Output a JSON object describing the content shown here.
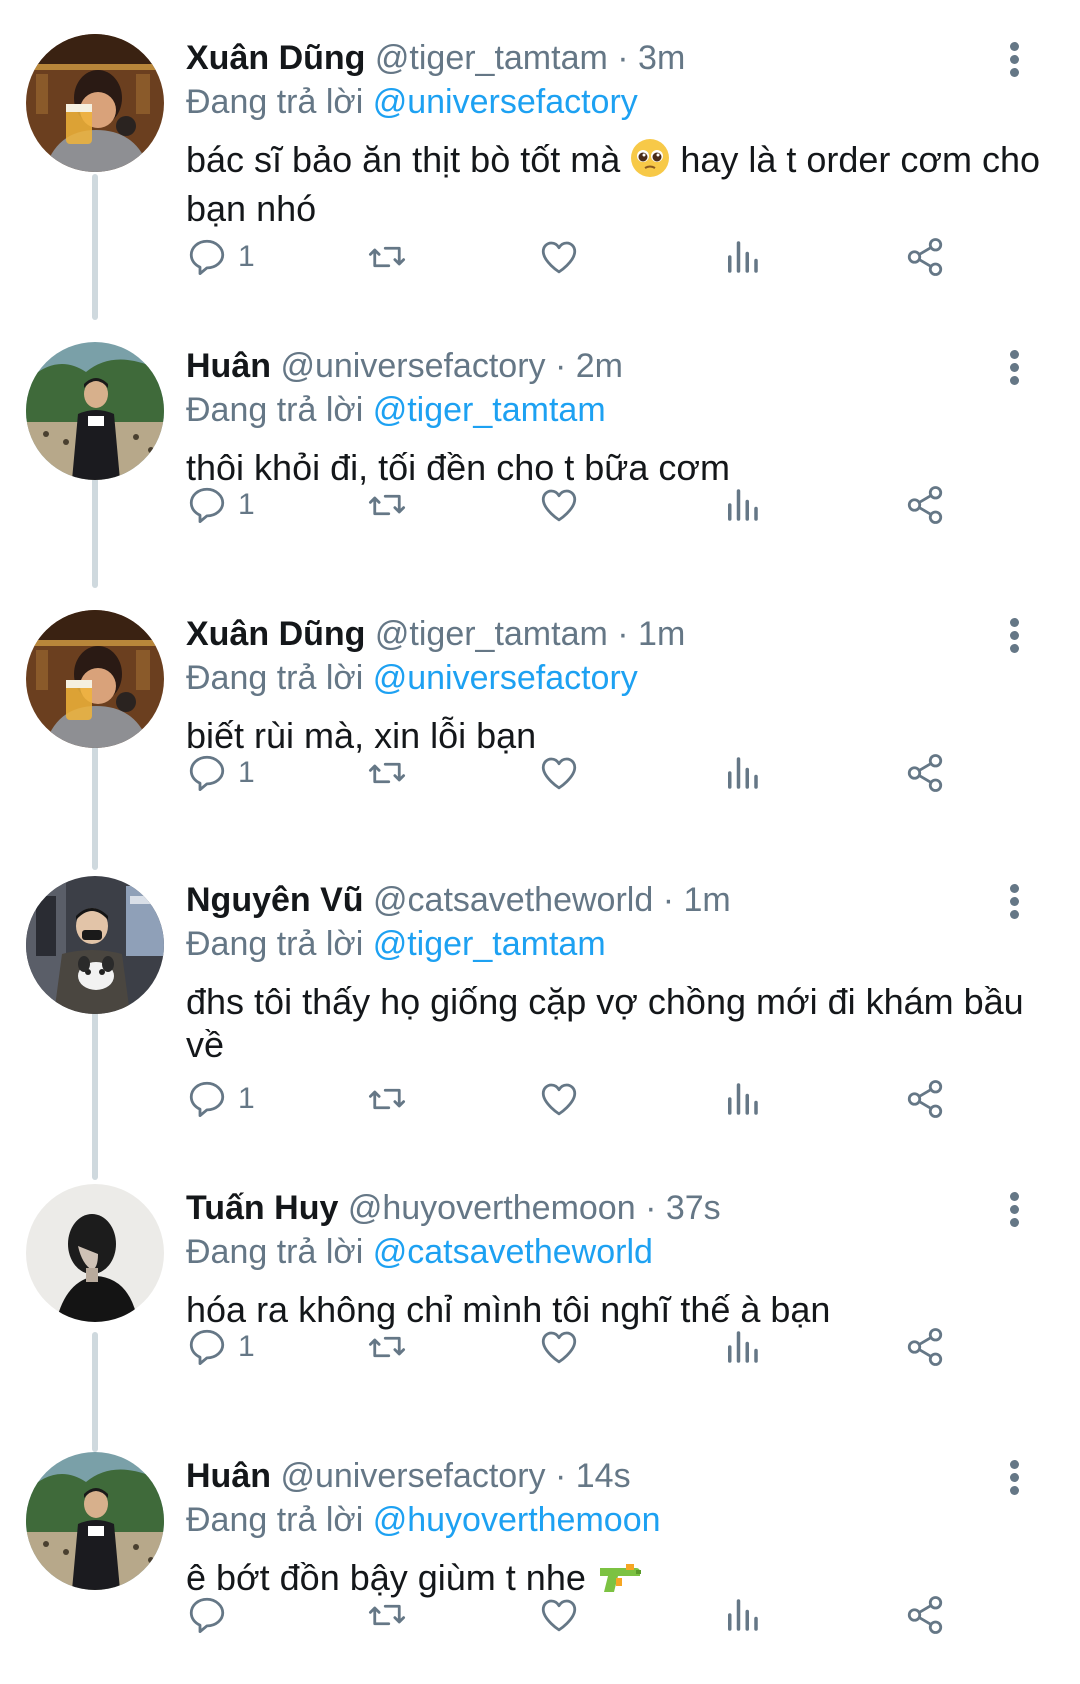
{
  "colors": {
    "text": "#14171a",
    "muted": "#657786",
    "link": "#1da1f2",
    "thread_line": "#cfd9de"
  },
  "reply_prefix": "Đang trả lời",
  "tweets": [
    {
      "name": "Xuân Dũng",
      "handle": "@tiger_tamtam",
      "dot": "·",
      "time": "3m",
      "reply_to": "@universefactory",
      "text": "bác sĩ bảo ăn thịt bò tốt mà",
      "text_after_emoji": "hay là t order cơm cho bạn nhó",
      "emoji": "pleading-face-emoji",
      "reply_count": "1",
      "avatar": "avatar-xuan-dung"
    },
    {
      "name": "Huân",
      "handle": "@universefactory",
      "dot": "·",
      "time": "2m",
      "reply_to": "@tiger_tamtam",
      "text": "thôi khỏi đi, tối đền cho t bữa cơm",
      "reply_count": "1",
      "avatar": "avatar-huan"
    },
    {
      "name": "Xuân Dũng",
      "handle": "@tiger_tamtam",
      "dot": "·",
      "time": "1m",
      "reply_to": "@universefactory",
      "text": "biết rùi mà, xin lỗi bạn",
      "reply_count": "1",
      "avatar": "avatar-xuan-dung"
    },
    {
      "name": "Nguyên Vũ",
      "handle": "@catsavetheworld",
      "dot": "·",
      "time": "1m",
      "reply_to": "@tiger_tamtam",
      "text": "đhs tôi thấy họ giống cặp vợ chồng mới đi khám bầu về",
      "reply_count": "1",
      "avatar": "avatar-nguyen-vu"
    },
    {
      "name": "Tuấn Huy",
      "handle": "@huyoverthemoon",
      "dot": "·",
      "time": "37s",
      "reply_to": "@catsavetheworld",
      "text": "hóa ra không chỉ mình tôi nghĩ thế à bạn",
      "reply_count": "1",
      "avatar": "avatar-tuan-huy"
    },
    {
      "name": "Huân",
      "handle": "@universefactory",
      "dot": "·",
      "time": "14s",
      "reply_to": "@huyoverthemoon",
      "text": "ê bớt đồn bậy giùm t nhe",
      "emoji": "water-pistol-emoji",
      "reply_count": "",
      "avatar": "avatar-huan"
    }
  ],
  "icons": {
    "reply": "reply-icon",
    "retweet": "retweet-icon",
    "like": "heart-icon",
    "analytics": "analytics-icon",
    "share": "share-icon",
    "more": "more-vertical-icon"
  }
}
